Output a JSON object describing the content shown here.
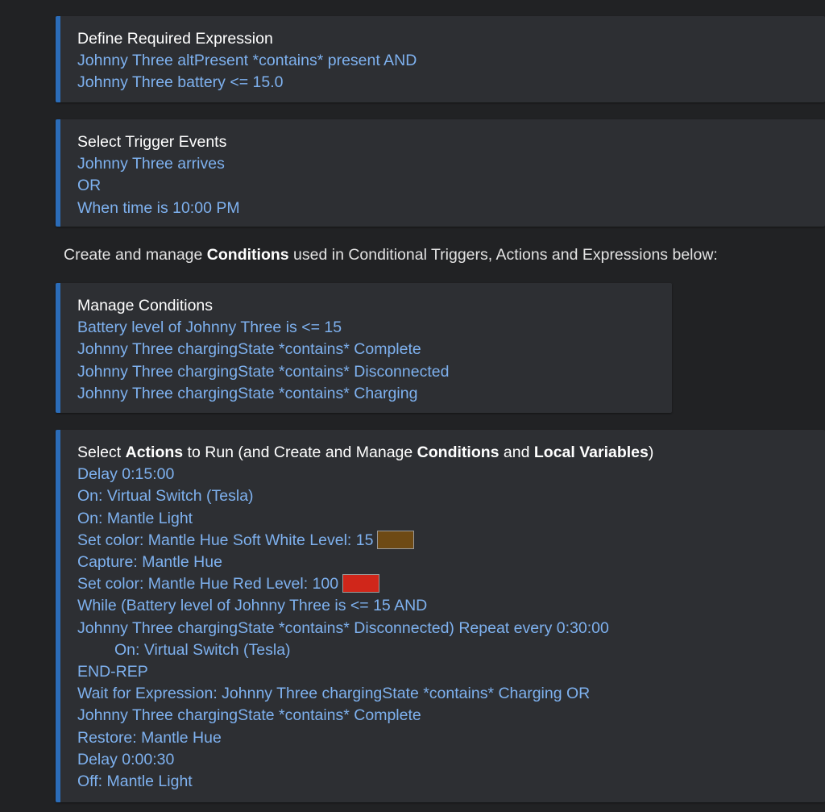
{
  "required_expression": {
    "title": "Define Required Expression",
    "lines": [
      "Johnny Three altPresent *contains* present  AND",
      "Johnny Three battery <= 15.0"
    ]
  },
  "trigger_events": {
    "title": "Select Trigger Events",
    "lines": [
      "Johnny Three arrives",
      "OR",
      "When time is 10:00 PM"
    ]
  },
  "info_text": {
    "prefix": "Create and manage ",
    "bold": "Conditions",
    "suffix": " used in Conditional Triggers, Actions and Expressions below:"
  },
  "conditions": {
    "title": "Manage Conditions",
    "lines": [
      "Battery level of Johnny Three is <= 15",
      "Johnny Three chargingState *contains* Complete",
      "Johnny Three chargingState *contains* Disconnected",
      "Johnny Three chargingState *contains* Charging"
    ]
  },
  "actions": {
    "title_parts": {
      "p1": "Select ",
      "b1": "Actions",
      "p2": " to Run (and Create and Manage ",
      "b2": "Conditions",
      "p3": " and ",
      "b3": "Local Variables",
      "p4": ")"
    },
    "lines": [
      "Delay 0:15:00",
      "On: Virtual Switch (Tesla)",
      "On: Mantle Light",
      "Set color: Mantle Hue  Soft White  Level: 15",
      "Capture: Mantle Hue",
      "Set color: Mantle Hue  Red  Level: 100",
      "While (Battery level of Johnny Three is <= 15  AND",
      "Johnny Three chargingState *contains* Disconnected) Repeat every 0:30:00",
      "On: Virtual Switch (Tesla)",
      "END-REP",
      "Wait for Expression: Johnny Three chargingState *contains* Charging  OR",
      "Johnny Three chargingState *contains* Complete",
      "Restore: Mantle Hue",
      "Delay 0:00:30",
      "Off: Mantle Light"
    ],
    "swatch_colors": {
      "soft_white": "#6e4a14",
      "red": "#d0261a"
    }
  },
  "colors": {
    "background": "#212224",
    "panel": "#2d2f33",
    "accent": "#2b6cb8",
    "link": "#7eb1ef"
  }
}
